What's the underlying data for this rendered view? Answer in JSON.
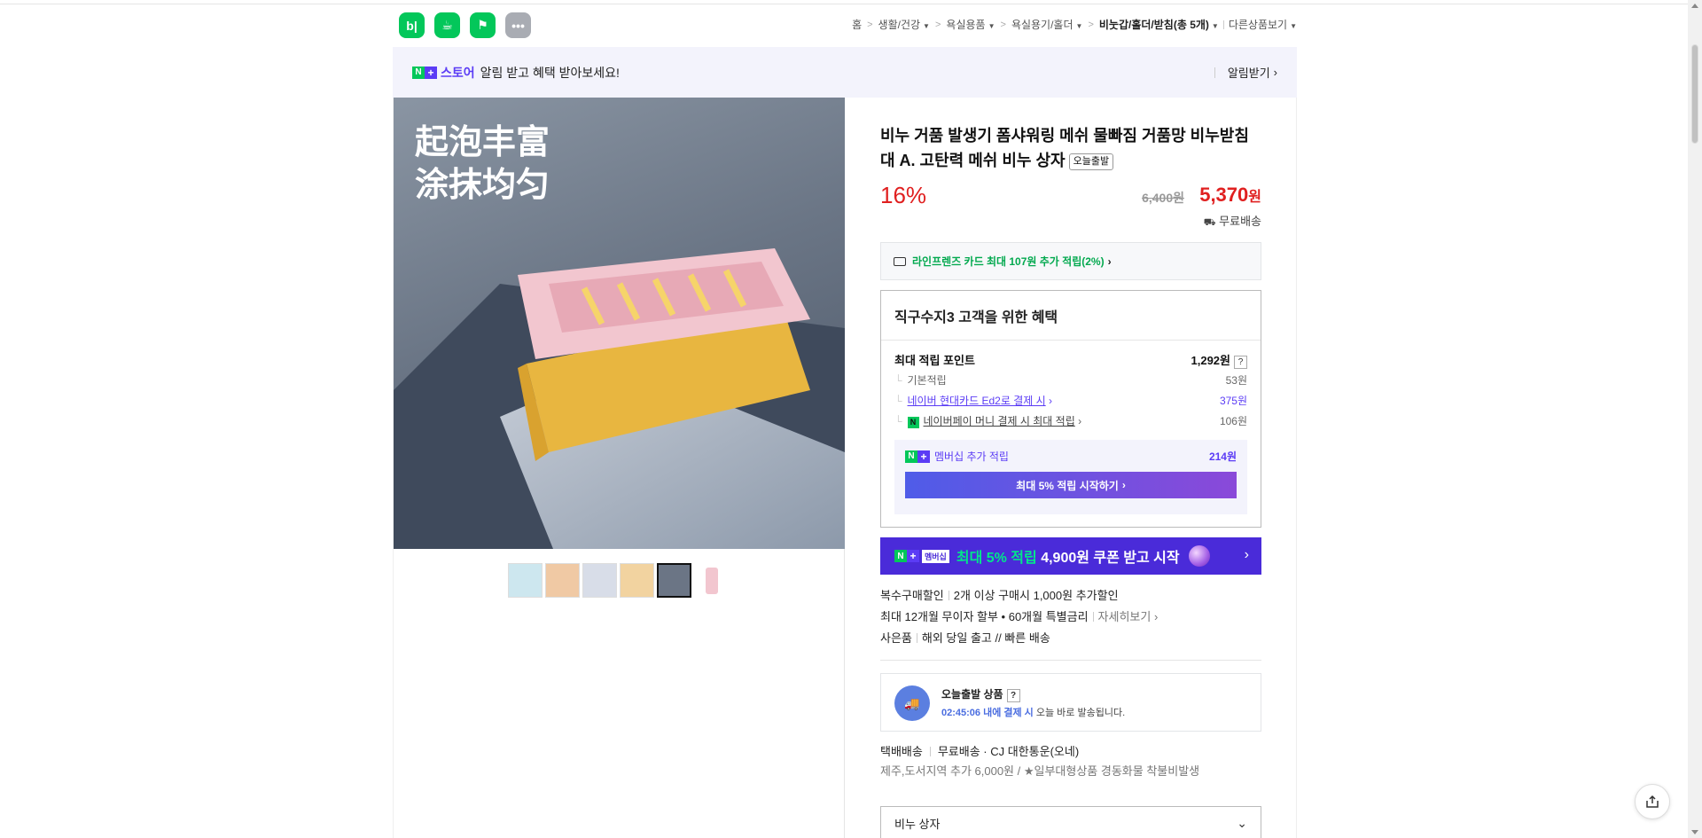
{
  "header": {
    "app_icons": [
      {
        "name": "blog-icon",
        "glyph": "b|"
      },
      {
        "name": "cafe-icon",
        "glyph": "☕"
      },
      {
        "name": "bookmark-icon",
        "glyph": "⚑"
      },
      {
        "name": "more-icon",
        "glyph": "•••"
      }
    ],
    "breadcrumb": {
      "home": "홈",
      "items": [
        "생활/건강",
        "욕실용품",
        "욕실용기/홀더"
      ],
      "current": "비눗갑/홀더/받침(총 5개)",
      "other": "다른상품보기"
    }
  },
  "notify": {
    "store_label": "스토어",
    "text": "알림 받고 혜택 받아보세요!",
    "action": "알림받기"
  },
  "product": {
    "image_text": [
      "起泡丰富",
      "涂抹均匀"
    ],
    "thumbnail_count": 6,
    "title": "비누 거품 발생기 폼샤워링 메쉬 물빠짐 거품망 비누받침대 A. 고탄력 메쉬 비누 상자",
    "today_badge": "오늘출발",
    "discount": "16%",
    "original_price": "6,400원",
    "sale_price_num": "5,370",
    "sale_price_unit": "원",
    "shipping": "무료배송",
    "card_benefit": "라인프렌즈 카드 최대 107원 추가 적립(2%)"
  },
  "benefit": {
    "title": "직구수지3 고객을 위한 혜택",
    "max_points_label": "최대 적립 포인트",
    "max_points_value": "1,292원",
    "rows": [
      {
        "label": "기본적립",
        "value": "53원"
      },
      {
        "label": "네이버 현대카드 Ed2로 결제 시",
        "value": "375원"
      },
      {
        "label": "네이버페이 머니 결제 시 최대 적립",
        "value": "106원"
      }
    ],
    "membership_label": "멤버십 추가 적립",
    "membership_value": "214원",
    "membership_button": "최대 5% 적립 시작하기"
  },
  "membership_banner": {
    "tag": "멤버십",
    "text_prefix": "최대 5% 적립",
    "text_rest": "4,900원 쿠폰 받고 시작"
  },
  "info": {
    "multi_label": "복수구매할인",
    "multi_value": "2개 이상 구매시 1,000원 추가할인",
    "installment": "최대 12개월 무이자 할부 • 60개월 특별금리",
    "installment_link": "자세히보기",
    "gift_label": "사은품",
    "gift_value": "해외 당일 출고 // 빠른 배송"
  },
  "today_ship": {
    "title": "오늘출발 상품",
    "time": "02:45:06 내에 결제 시",
    "rest": "오늘 바로 발송됩니다."
  },
  "courier": {
    "type": "택배배송",
    "fee": "무료배송",
    "company": "CJ 대한통운(오네)",
    "note": "제주,도서지역 추가 6,000원 / ★일부대형상품 경동화물 착불비발생"
  },
  "option": {
    "label": "비누 상자"
  },
  "colors": {
    "naver_green": "#03c75a",
    "plus_purple": "#5b3cf5",
    "price_red": "#e02020"
  }
}
